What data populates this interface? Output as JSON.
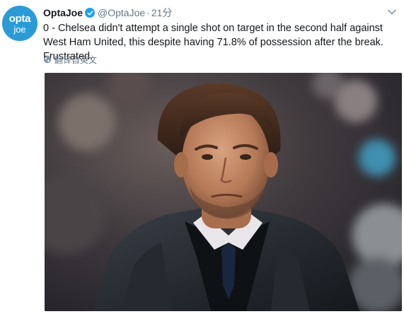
{
  "tweet": {
    "avatar": {
      "line1": "opta",
      "line2": "joe"
    },
    "display_name": "OptaJoe",
    "handle": "@OptaJoe",
    "separator": "·",
    "time": "21分",
    "text": "0 - Chelsea didn't attempt a single shot on target in the second half against West Ham United, this despite having 71.8% of possession after the break. Frustrated.",
    "translate_label": "翻译自英文",
    "icons": {
      "verified": "verified-badge-icon",
      "caret": "chevron-down-icon",
      "globe": "globe-icon"
    },
    "colors": {
      "brand": "#2b9bd8",
      "verified": "#1da1f2",
      "muted": "#657786"
    }
  }
}
